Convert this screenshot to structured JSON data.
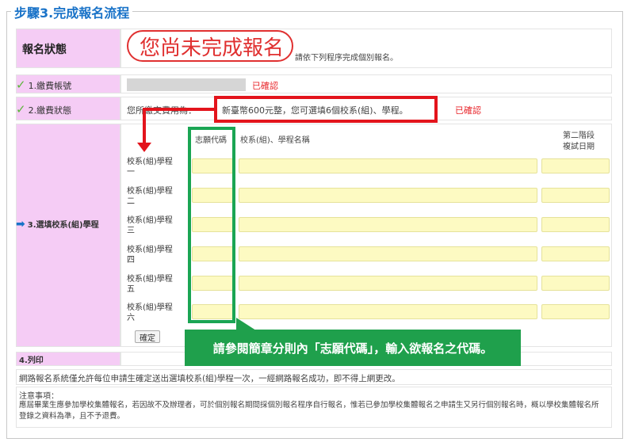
{
  "legend": "步驟3.完成報名流程",
  "status": {
    "label": "報名狀態",
    "value": "您尚未完成報名",
    "hint": "請依下列程序完成個別報名。"
  },
  "steps": {
    "step1": {
      "label": "1.繳費帳號",
      "status": "已確認"
    },
    "step2": {
      "label": "2.繳費狀態",
      "prefix": "您所繳交費用為：",
      "text": "新臺幣600元整，您可選填6個校系(組)、學程。",
      "status": "已確認"
    },
    "step3": {
      "label": "3.選填校系(組)學程"
    },
    "step4": {
      "label": "4.列印"
    }
  },
  "table": {
    "col_code": "志願代碼",
    "col_name": "校系(組)、學程名稱",
    "col_date_line1": "第二階段",
    "col_date_line2": "複試日期",
    "rows": [
      {
        "l1": "校系(組)學程",
        "l2": "一"
      },
      {
        "l1": "校系(組)學程",
        "l2": "二"
      },
      {
        "l1": "校系(組)學程",
        "l2": "三"
      },
      {
        "l1": "校系(組)學程",
        "l2": "四"
      },
      {
        "l1": "校系(組)學程",
        "l2": "五"
      },
      {
        "l1": "校系(組)學程",
        "l2": "六"
      }
    ],
    "confirm": "確定"
  },
  "callout": "請參閱簡章分則內「志願代碼」，輸入欲報名之代碼。",
  "footer": {
    "line1": "網路報名系統僅允許每位申請生確定送出選填校系(組)學程一次，一經網路報名成功，即不得上網更改。",
    "note_title": "注意事項：",
    "note_body": "應屆畢業生應參加學校集體報名，若因故不及辦理者，可於個別報名期間採個別報名程序自行報名，惟若已參加學校集體報名之申請生又另行個別報名時，概以學校集體報名所登錄之資料為準，且不予退費。"
  },
  "colors": {
    "accent": "#1a73c8",
    "pink": "#f5ccf5",
    "red": "#e3141c",
    "green": "#1fa04c",
    "yellow": "#fdfac2"
  }
}
